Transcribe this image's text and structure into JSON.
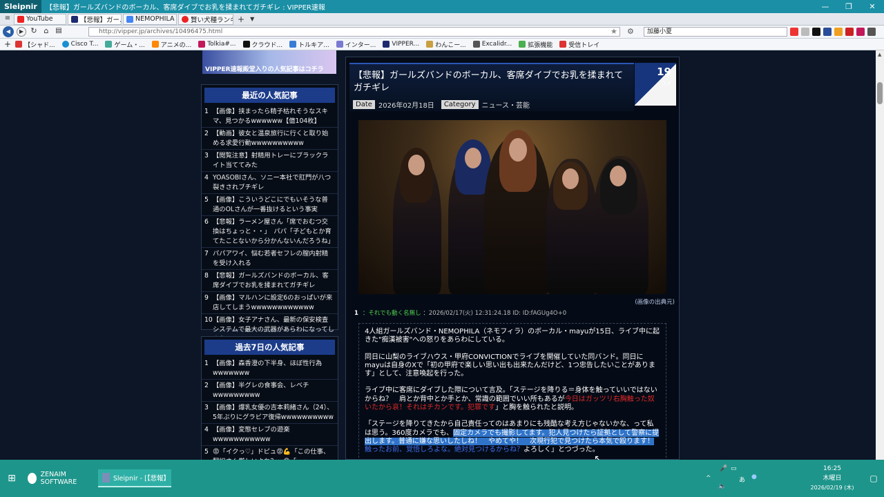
{
  "browser": {
    "app_name": "Sleipnir",
    "window_title": "【悲報】ガールズバンドのボーカル、客席ダイブでお乳を揉まれてガチギレ : VIPPER速報",
    "tabs": [
      {
        "label": "YouTube",
        "color": "#e22"
      },
      {
        "label": "【悲報】ガールズバ",
        "color": "#1c2a70"
      },
      {
        "label": "NEMOPHILA - ...",
        "color": "#4285f4"
      },
      {
        "label": "賢い犬種ランキン...",
        "color": "#e22"
      }
    ],
    "url": "http://vipper.jp/archives/10496475.html",
    "search_value": "加藤小夏",
    "bookmarks": [
      "【シャド...",
      "Cisco T...",
      "ゲーム・...",
      "アニメの...",
      "Tolkia#...",
      "クラウド...",
      "トルキア...",
      "インター...",
      "VIPPER...",
      "わんこー...",
      "Excalidr...",
      "拡張機能",
      "受信トレイ"
    ]
  },
  "sidebar": {
    "banner_text": "VIPPER速報殿堂入りの人気記事はコチラ",
    "recent": {
      "title": "最近の人気記事",
      "items": [
        {
          "n": "1",
          "text": "【画像】挟まったら精子枯れそうなスキマ、見つかるwwwwww【億104枚】"
        },
        {
          "n": "2",
          "text": "【動画】彼女と温泉旅行に行くと取り始める求愛行動wwwwwwwwww"
        },
        {
          "n": "3",
          "text": "【閲覧注意】射精用トレーにブラックライト当ててみた"
        },
        {
          "n": "4",
          "text": "YOASOBIさん、ソニー本社で肛門が八つ裂きされブチギレ"
        },
        {
          "n": "5",
          "text": "【画像】こういうどこにでもいそうな普通のOLさんが一番抜けるという事実"
        },
        {
          "n": "6",
          "text": "【悲報】ラーメン屋さん「席でおむつ交換はちょっと・・」　パパ「子どもとか育てたことないから分かんないんだろうね」"
        },
        {
          "n": "7",
          "text": "パパアワイ、悩む若者セフレの膣内射精を受け入れる"
        },
        {
          "n": "8",
          "text": "【悲報】ガールズバンドのボーカル、客席ダイブでお乳を揉まれてガチギレ"
        },
        {
          "n": "9",
          "text": "【画像】マルハンに設定6のおっぱいが来店してしまうwwwwwwwwwwww"
        },
        {
          "n": "10",
          "text": "【画像】女子アナさん、最新の保安検査システムで最大の武器があらわになってしまうwwwwwww"
        }
      ]
    },
    "weekly": {
      "title": "過去7日の人気記事",
      "items": [
        {
          "n": "1",
          "text": "【画像】森香澄の下半身、ほぼ性行為wwwwwww"
        },
        {
          "n": "2",
          "text": "【画像】半グレの食事会、レベチwwwwwwwww"
        },
        {
          "n": "3",
          "text": "【画像】爆乳女優の吉本莉緒さん（24）、5年ぶりにグラビア復帰wwwwwwwwww"
        },
        {
          "n": "4",
          "text": "【画像】変態セレブの遊楽wwwwwwwwwww"
        },
        {
          "n": "5",
          "text": "😡「イクっ♡」ドピュ😡💪「この仕事、翻訳さん厳しいよね？」😩「…」"
        }
      ]
    }
  },
  "article": {
    "title": "【悲報】ガールズバンドのボーカル、客席ダイブでお乳を揉まれてガチギレ",
    "date_label": "Date",
    "date": "2026年02月18日",
    "category_label": "Category",
    "category": "ニュース・芸能",
    "comment_count": "19",
    "comment_unit": "コメ",
    "image_credit": "(画像の出典元)",
    "comment": {
      "num": "1",
      "name": "：それでも動く名無し",
      "meta": "：2026/02/17(火) 12:31:24.18 ID: ID:fAGUg4O+0",
      "p1": "4人組ガールズバンド・NEMOPHILA（ネモフィラ）のボーカル・mayuが15日、ライブ中に起きた\"痴漢被害\"への怒りをあらわにしている。",
      "p2": "同日に山梨のライブハウス・甲府CONVICTIONでライブを開催していた同バンド。同日にmayuは自身のXで「初の甲府で楽しい思い出も出来たんだけど、1つ忠告したいことがあります」として、注意喚起を行った。",
      "p3a": "ライブ中に客席にダイブした際について言及。「ステージを降りる＝身体を触っていいではないからね？　肩とか背中とか手とか、常識の範囲でいい所もあるが",
      "p3red": "今日はガッツリ右胸触った奴いたから哀！それはチカンです。犯罪です",
      "p3b": "」と胸を触られたと説明。",
      "p4a": "「ステージを降りてきたから自己責任ってのはあまりにも残酷な考え方じゃないかな、って私は思う。360度カメラでも、",
      "p4sel": "固定カメラでも撮影してます。犯人見つけたら証拠として警察に提出します。普通に嫌な思いしたしね！　やめてや！　次現行犯で見つけたら本気で殴ります！",
      "p4blu": "触ったお前、覚悟しろよな。絶対見つけるからね？",
      "p4b": "よろしく」とつづった。"
    }
  },
  "taskbar": {
    "items": [
      "ZENAIM SOFTWARE",
      "Sleipnir - [【悲報】ガ..."
    ],
    "ime": "あ",
    "time": "16:25",
    "weekday": "木曜日",
    "date": "2026/02/19 (木)"
  }
}
